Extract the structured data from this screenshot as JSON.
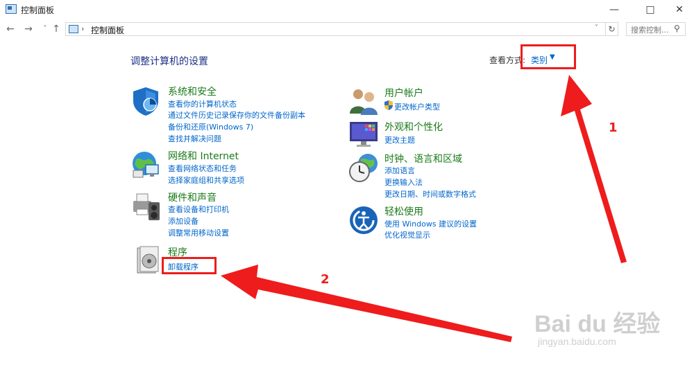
{
  "window": {
    "title": "控制面板",
    "minimize_icon": "minimize-icon",
    "maximize_icon": "maximize-icon",
    "close_icon": "close-icon"
  },
  "nav": {
    "back": "←",
    "forward": "→",
    "recent": "˅",
    "up": "↑"
  },
  "address": {
    "separator": "›",
    "crumb": "控制面板",
    "dropdown": "˅",
    "refresh": "↻"
  },
  "search": {
    "placeholder": "搜索控制...",
    "icon": "search-icon"
  },
  "header": {
    "title": "调整计算机的设置",
    "view_by_label": "查看方式:",
    "view_by_value": "类别"
  },
  "categories": [
    {
      "title": "系统和安全",
      "icon": "shield-icon",
      "links": [
        "查看你的计算机状态",
        "通过文件历史记录保存你的文件备份副本",
        "备份和还原(Windows 7)",
        "查找并解决问题"
      ]
    },
    {
      "title": "网络和 Internet",
      "icon": "network-globe-icon",
      "links": [
        "查看网络状态和任务",
        "选择家庭组和共享选项"
      ]
    },
    {
      "title": "硬件和声音",
      "icon": "printer-icon",
      "links": [
        "查看设备和打印机",
        "添加设备",
        "调整常用移动设置"
      ]
    },
    {
      "title": "程序",
      "icon": "programs-icon",
      "links": [
        "卸载程序"
      ]
    },
    {
      "title": "用户帐户",
      "icon": "users-icon",
      "links": [
        "更改帐户类型"
      ]
    },
    {
      "title": "外观和个性化",
      "icon": "monitor-icon",
      "links": [
        "更改主题"
      ]
    },
    {
      "title": "时钟、语言和区域",
      "icon": "clock-globe-icon",
      "links": [
        "添加语言",
        "更换输入法",
        "更改日期、时间或数字格式"
      ]
    },
    {
      "title": "轻松使用",
      "icon": "ease-of-access-icon",
      "links": [
        "使用 Windows 建议的设置",
        "优化视觉显示"
      ]
    }
  ],
  "annotations": {
    "marker1": "1",
    "marker2": "2",
    "color": "#ee1c1c"
  },
  "watermark": {
    "brand": "Bai du 经验",
    "url": "jingyan.baidu.com"
  }
}
